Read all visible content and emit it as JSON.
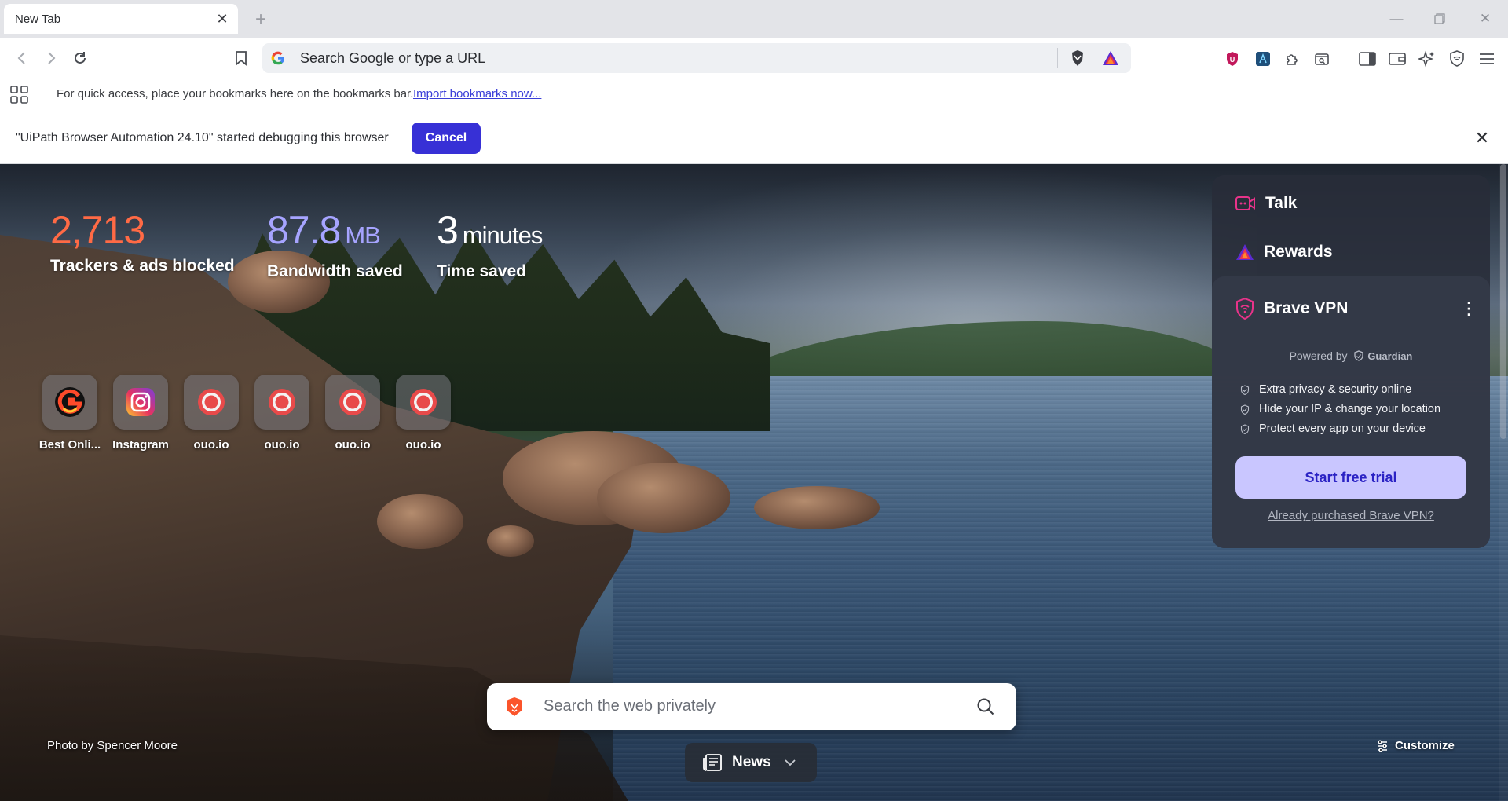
{
  "tab": {
    "title": "New Tab"
  },
  "toolbar": {
    "omnibox_placeholder": "Search Google or type a URL"
  },
  "bookmarks_bar": {
    "message": "For quick access, place your bookmarks here on the bookmarks bar.",
    "import_link": "Import bookmarks now..."
  },
  "infobar": {
    "message": "\"UiPath Browser Automation 24.10\" started debugging this browser",
    "cancel_label": "Cancel"
  },
  "stats": [
    {
      "value": "2,713",
      "unit": "",
      "label": "Trackers & ads blocked",
      "color": "#ff6a45"
    },
    {
      "value": "87.8",
      "unit": "MB",
      "label": "Bandwidth saved",
      "color": "#a6a4ff"
    },
    {
      "value": "3",
      "unit": "minutes",
      "label": "Time saved",
      "color": "#ffffff"
    }
  ],
  "top_sites": [
    {
      "label": "Best Onli...",
      "icon": "best-online-icon"
    },
    {
      "label": "Instagram",
      "icon": "instagram-icon"
    },
    {
      "label": "ouo.io",
      "icon": "ouo-icon"
    },
    {
      "label": "ouo.io",
      "icon": "ouo-icon"
    },
    {
      "label": "ouo.io",
      "icon": "ouo-icon"
    },
    {
      "label": "ouo.io",
      "icon": "ouo-icon"
    }
  ],
  "right_panel": {
    "talk_label": "Talk",
    "rewards_label": "Rewards",
    "vpn": {
      "title": "Brave VPN",
      "powered_by": "Powered by",
      "powered_brand": "Guardian",
      "features": [
        "Extra privacy & security online",
        "Hide your IP & change your location",
        "Protect every app on your device"
      ],
      "trial_button": "Start free trial",
      "purchased_link": "Already purchased Brave VPN?"
    }
  },
  "search": {
    "placeholder": "Search the web privately"
  },
  "photo_credit": "Photo by Spencer Moore",
  "news_label": "News",
  "customize_label": "Customize",
  "colors": {
    "accent": "#3730d6",
    "brave_orange": "#fb542b",
    "vpn_button": "#c9c6ff"
  }
}
